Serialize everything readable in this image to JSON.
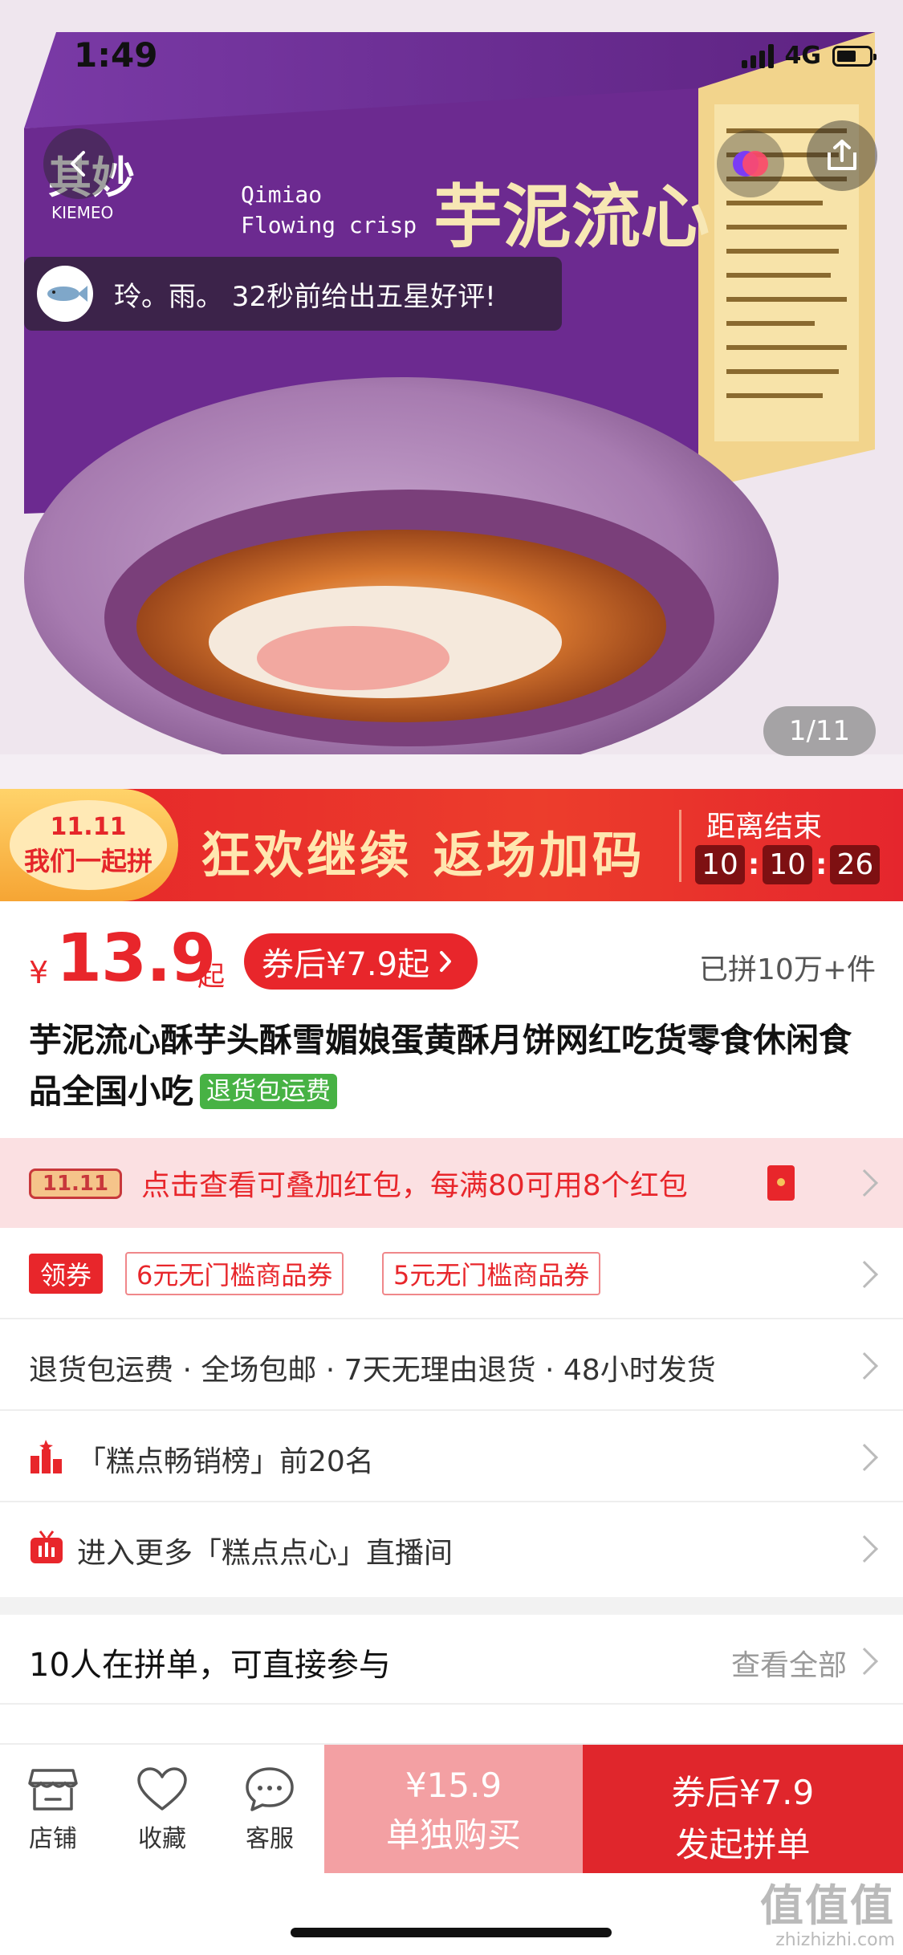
{
  "status_bar": {
    "time": "1:49",
    "network": "4G"
  },
  "hero": {
    "brand_logo": "其妙",
    "brand_logo_sub": "KIEMEO",
    "english_line1": "Qimiao",
    "english_line2": "Flowing crisp",
    "product_name_art": "芋泥流心",
    "toast_text": "玲。雨。 32秒前给出五星好评!",
    "image_counter": "1/11"
  },
  "banner": {
    "badge_line1": "11.11",
    "badge_line2": "我们一起拼",
    "slogan": "狂欢继续 返场加码",
    "ends_label": "距离结束",
    "countdown": [
      "10",
      "10",
      "26"
    ]
  },
  "price": {
    "currency": "¥",
    "amount": "13.9",
    "suffix": "起",
    "coupon_pill": "券后¥7.9起",
    "sold": "已拼10万+件"
  },
  "product": {
    "title": "芋泥流心酥芋头酥雪媚娘蛋黄酥月饼网红吃货零食休闲食品全国小吃",
    "tag": "退货包运费"
  },
  "red_packet": {
    "badge": "11.11",
    "text": "点击查看可叠加红包，每满80可用8个红包"
  },
  "coupons": {
    "label": "领券",
    "items": [
      "6元无门槛商品券",
      "5元无门槛商品券"
    ]
  },
  "services": "退货包运费 · 全场包邮 · 7天无理由退货 · 48小时发货",
  "ranking": "「糕点畅销榜」前20名",
  "live": "进入更多「糕点点心」直播间",
  "group": {
    "heading": "10人在拼单，可直接参与",
    "view_all": "查看全部"
  },
  "bottom": {
    "tabs": [
      "店铺",
      "收藏",
      "客服"
    ],
    "solo_price": "¥15.9",
    "solo_label": "单独购买",
    "group_price": "券后¥7.9",
    "group_label": "发起拼单"
  },
  "watermark": {
    "main": "值值值",
    "sub": "zhizhizhi.com"
  },
  "colors": {
    "accent_red": "#e8262b",
    "green_tag": "#47b244",
    "pink_band": "#fbe0e2",
    "product_purple": "#6c2a90"
  }
}
